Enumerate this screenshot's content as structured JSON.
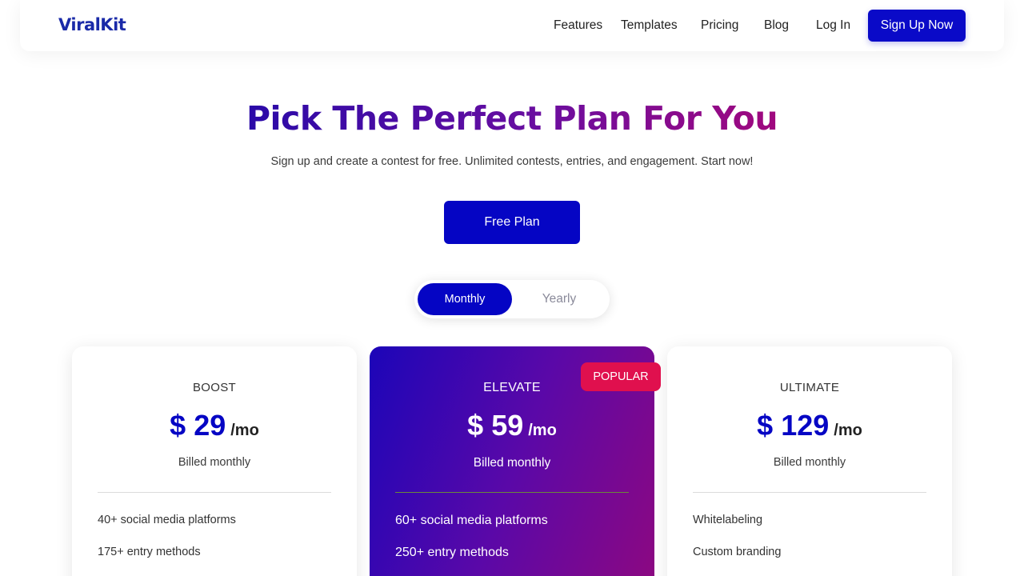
{
  "nav": {
    "logo": "ViralKit",
    "links": [
      "Features",
      "Templates",
      "Pricing",
      "Blog"
    ],
    "login": "Log In",
    "signup": "Sign Up Now"
  },
  "hero": {
    "title": "Pick The Perfect Plan For You",
    "subtitle": "Sign up and create a contest for free. Unlimited contests, entries, and engagement. Start now!",
    "free_button": "Free Plan"
  },
  "billing_toggle": {
    "options": [
      "Monthly",
      "Yearly"
    ],
    "selected": "Monthly"
  },
  "plans": [
    {
      "name": "BOOST",
      "price": "$ 29",
      "period": "/mo",
      "billed": "Billed monthly",
      "features": [
        "40+ social media platforms",
        "175+ entry methods"
      ]
    },
    {
      "name": "ELEVATE",
      "price": "$ 59",
      "period": "/mo",
      "billed": "Billed monthly",
      "badge": "POPULAR",
      "features": [
        "60+ social media platforms",
        "250+ entry methods"
      ]
    },
    {
      "name": "ULTIMATE",
      "price": "$ 129",
      "period": "/mo",
      "billed": "Billed monthly",
      "features": [
        "Whitelabeling",
        "Custom branding"
      ]
    }
  ],
  "colors": {
    "primary": "#0505c4",
    "badge": "#e0104e",
    "gradient_start": "#1c05b8",
    "gradient_end": "#8e0880"
  }
}
